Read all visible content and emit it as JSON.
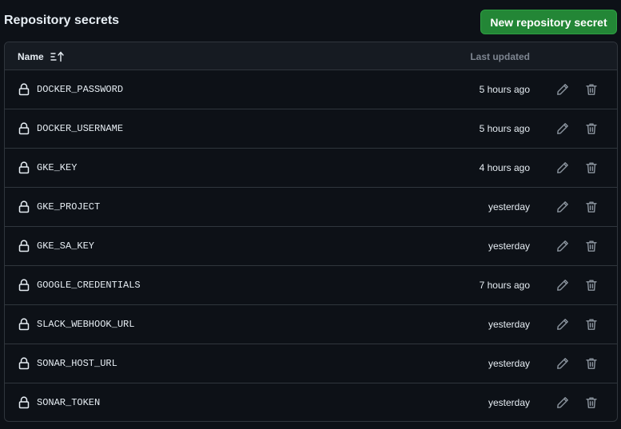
{
  "header": {
    "title": "Repository secrets",
    "new_button_label": "New repository secret"
  },
  "table": {
    "columns": {
      "name": "Name",
      "last_updated": "Last updated"
    },
    "rows": [
      {
        "name": "DOCKER_PASSWORD",
        "updated": "5 hours ago"
      },
      {
        "name": "DOCKER_USERNAME",
        "updated": "5 hours ago"
      },
      {
        "name": "GKE_KEY",
        "updated": "4 hours ago"
      },
      {
        "name": "GKE_PROJECT",
        "updated": "yesterday"
      },
      {
        "name": "GKE_SA_KEY",
        "updated": "yesterday"
      },
      {
        "name": "GOOGLE_CREDENTIALS",
        "updated": "7 hours ago"
      },
      {
        "name": "SLACK_WEBHOOK_URL",
        "updated": "yesterday"
      },
      {
        "name": "SONAR_HOST_URL",
        "updated": "yesterday"
      },
      {
        "name": "SONAR_TOKEN",
        "updated": "yesterday"
      }
    ]
  },
  "icons": {
    "sort": "sort-ascending-icon",
    "lock": "lock-icon",
    "edit": "pencil-icon",
    "delete": "trash-icon"
  },
  "colors": {
    "background": "#0d1117",
    "header_bg": "#161b22",
    "border": "#30363d",
    "primary_button": "#238636",
    "muted_text": "#7d8590",
    "icon": "#8b949e"
  }
}
